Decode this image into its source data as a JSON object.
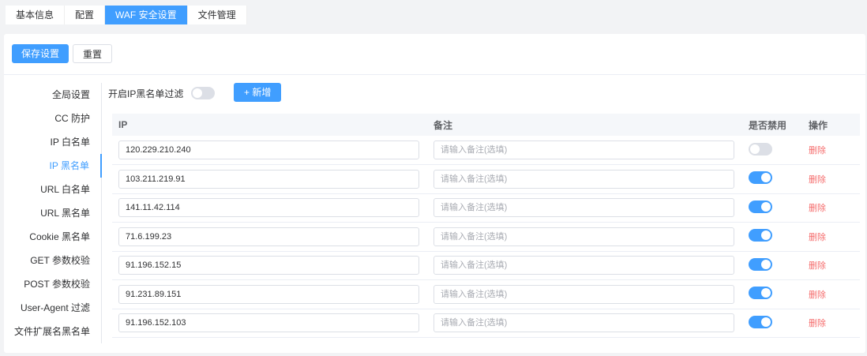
{
  "tabs": [
    "基本信息",
    "配置",
    "WAF 安全设置",
    "文件管理"
  ],
  "toolbar": {
    "save": "保存设置",
    "reset": "重置"
  },
  "menu": [
    "全局设置",
    "CC 防护",
    "IP 白名单",
    "IP 黑名单",
    "URL 白名单",
    "URL 黑名单",
    "Cookie 黑名单",
    "GET 参数校验",
    "POST 参数校验",
    "User-Agent 过滤",
    "文件扩展名黑名单"
  ],
  "filter": {
    "label": "开启IP黑名单过滤",
    "enabled": false,
    "add": "+ 新增"
  },
  "table": {
    "headers": [
      "IP",
      "备注",
      "是否禁用",
      "操作"
    ],
    "remark_placeholder": "请输入备注(选填)",
    "delete": "删除",
    "rows": [
      {
        "ip": "120.229.210.240",
        "disabled": false
      },
      {
        "ip": "103.211.219.91",
        "disabled": true
      },
      {
        "ip": "141.11.42.114",
        "disabled": true
      },
      {
        "ip": "71.6.199.23",
        "disabled": true
      },
      {
        "ip": "91.196.152.15",
        "disabled": true
      },
      {
        "ip": "91.231.89.151",
        "disabled": true
      },
      {
        "ip": "91.196.152.103",
        "disabled": true
      }
    ]
  }
}
